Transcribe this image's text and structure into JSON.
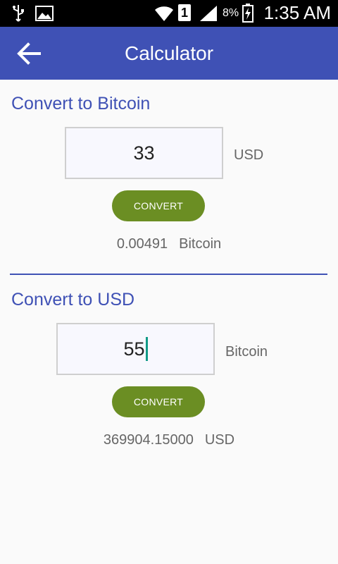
{
  "status_bar": {
    "time": "1:35 AM",
    "battery_percent": "8%",
    "sim_slot": "1",
    "icons": [
      "usb-icon",
      "image-notification-icon",
      "wifi-icon",
      "sim-icon",
      "signal-icon",
      "battery-charging-icon"
    ]
  },
  "app_bar": {
    "title": "Calculator",
    "back_icon": "arrow-back-icon",
    "color": "#3f51b5"
  },
  "to_bitcoin": {
    "title": "Convert to Bitcoin",
    "input_value": "33",
    "input_unit": "USD",
    "button_label": "CONVERT",
    "result_value": "0.00491",
    "result_unit": "Bitcoin"
  },
  "to_usd": {
    "title": "Convert to USD",
    "input_value": "55",
    "input_unit": "Bitcoin",
    "button_label": "CONVERT",
    "result_value": "369904.15000",
    "result_unit": "USD"
  },
  "colors": {
    "accent": "#3f51b5",
    "button": "#6b8e23",
    "caret": "#119a87"
  }
}
